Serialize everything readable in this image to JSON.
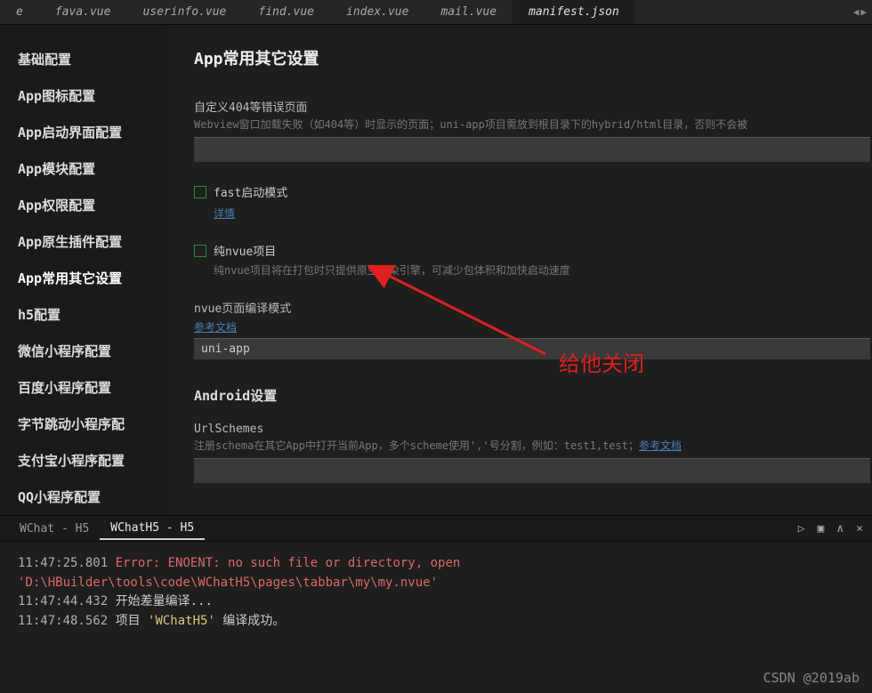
{
  "tabs": {
    "items": [
      {
        "label": "e"
      },
      {
        "label": "fava.vue"
      },
      {
        "label": "userinfo.vue"
      },
      {
        "label": "find.vue"
      },
      {
        "label": "index.vue"
      },
      {
        "label": "mail.vue"
      },
      {
        "label": "manifest.json"
      }
    ]
  },
  "sidebar": {
    "items": [
      {
        "label": "基础配置"
      },
      {
        "label": "App图标配置"
      },
      {
        "label": "App启动界面配置"
      },
      {
        "label": "App模块配置"
      },
      {
        "label": "App权限配置"
      },
      {
        "label": "App原生插件配置"
      },
      {
        "label": "App常用其它设置"
      },
      {
        "label": "h5配置"
      },
      {
        "label": "微信小程序配置"
      },
      {
        "label": "百度小程序配置"
      },
      {
        "label": "字节跳动小程序配"
      },
      {
        "label": "支付宝小程序配置"
      },
      {
        "label": "QQ小程序配置"
      }
    ]
  },
  "content": {
    "title": "App常用其它设置",
    "error404": {
      "label": "自定义404等错误页面",
      "desc": "Webview窗口加载失败（如404等）时显示的页面；uni-app项目需放到根目录下的hybrid/html目录，否则不会被"
    },
    "fast": {
      "label": "fast启动模式",
      "link": "详情"
    },
    "nvue": {
      "label": "纯nvue项目",
      "desc": "纯nvue项目将在打包时只提供原生渲染引擎，可减少包体积和加快启动速度"
    },
    "compile": {
      "label": "nvue页面编译模式",
      "link": "参考文档",
      "value": "uni-app"
    },
    "android": {
      "title": "Android设置",
      "urlschemes": {
        "label": "UrlSchemes",
        "desc_pre": "注册schema在其它App中打开当前App，多个scheme使用','号分割，例如：test1,test；",
        "link": "参考文档"
      }
    }
  },
  "annotation": "给他关闭",
  "consoleTabs": {
    "items": [
      {
        "label": "WChat - H5"
      },
      {
        "label": "WChatH5 - H5"
      }
    ]
  },
  "console": {
    "line1_ts": "11:47:25.801",
    "line1_err": " Error: ENOENT: no such file or directory, open 'D:\\HBuilder\\tools\\code\\WChatH5\\pages\\tabbar\\my\\my.nvue'",
    "line2_ts": "11:47:44.432",
    "line2_txt": " 开始差量编译...",
    "line3_ts": "11:47:48.562",
    "line3_pre": " 项目 ",
    "line3_hl": "'WChatH5'",
    "line3_post": " 编译成功。"
  },
  "watermark": "CSDN @2019ab"
}
